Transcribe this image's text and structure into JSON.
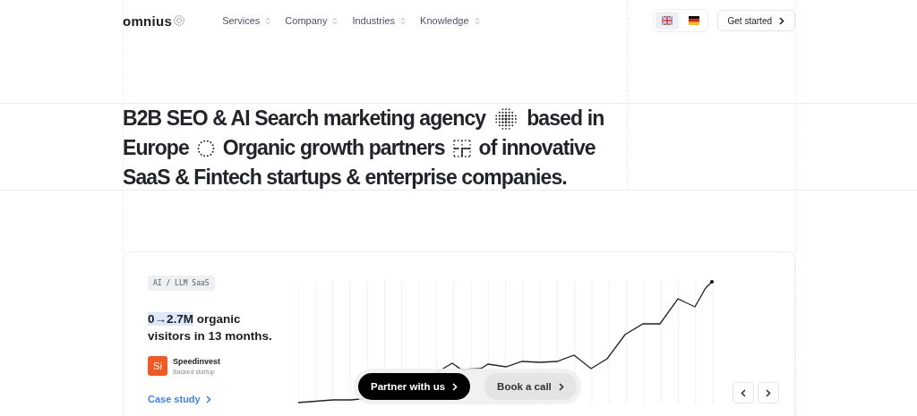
{
  "header": {
    "logo": "omnius",
    "nav": [
      {
        "label": "Services"
      },
      {
        "label": "Company"
      },
      {
        "label": "Industries"
      },
      {
        "label": "Knowledge"
      }
    ],
    "languages": [
      {
        "kind": "uk",
        "selected": true
      },
      {
        "kind": "de",
        "selected": false
      }
    ],
    "cta": "Get started"
  },
  "hero": {
    "lines": [
      [
        {
          "kind": "text",
          "text": "B2B SEO & AI Search marketing agency"
        },
        {
          "kind": "sphere"
        },
        {
          "kind": "text",
          "text": "based in"
        }
      ],
      [
        {
          "kind": "text",
          "text": "Europe"
        },
        {
          "kind": "ring"
        },
        {
          "kind": "text",
          "text": "Organic growth partners"
        },
        {
          "kind": "grid"
        },
        {
          "kind": "text",
          "text": "of innovative"
        }
      ],
      [
        {
          "kind": "text",
          "text": "SaaS & Fintech startups & enterprise companies."
        }
      ]
    ]
  },
  "case": {
    "tag": "AI / LLM SaaS",
    "highlight": "0→2.7M",
    "headline": "organic visitors in 13 months.",
    "client_logo": "Si",
    "client": "Speedinvest",
    "client_note": "Backed startup",
    "link": "Case study"
  },
  "actions": [
    "Partner with us",
    "Book a call"
  ]
}
